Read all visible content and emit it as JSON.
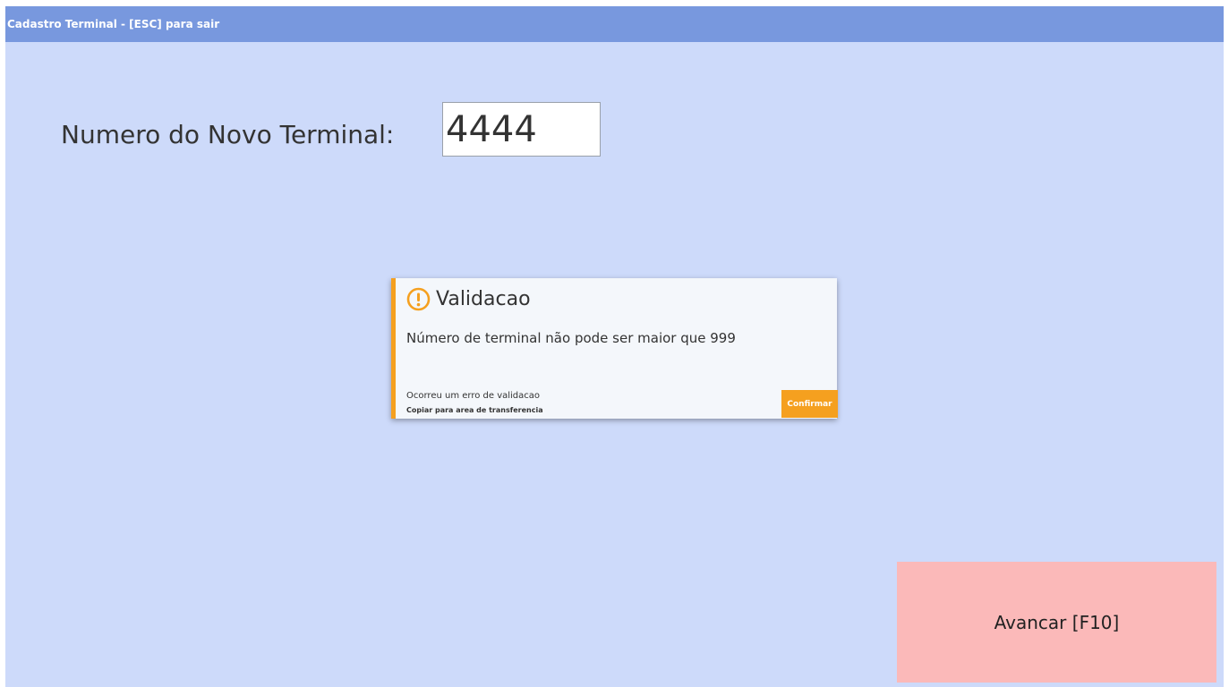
{
  "window": {
    "title": "Cadastro Terminal - [ESC] para sair"
  },
  "form": {
    "terminal_label": "Numero do Novo Terminal:",
    "terminal_value": "4444"
  },
  "toast": {
    "icon": "warning-circle-icon",
    "title": "Validacao",
    "message": "Número de terminal não pode ser maior que 999",
    "footer_text": "Ocorreu um erro de validacao",
    "copy_link": "Copiar para area de transferencia",
    "confirm_label": "Confirmar",
    "accent_color": "#f5a01f"
  },
  "actions": {
    "advance_label": "Avancar [F10]"
  },
  "colors": {
    "titlebar": "#7898de",
    "background": "#cddafa",
    "advance_button": "#fbb9b9"
  }
}
